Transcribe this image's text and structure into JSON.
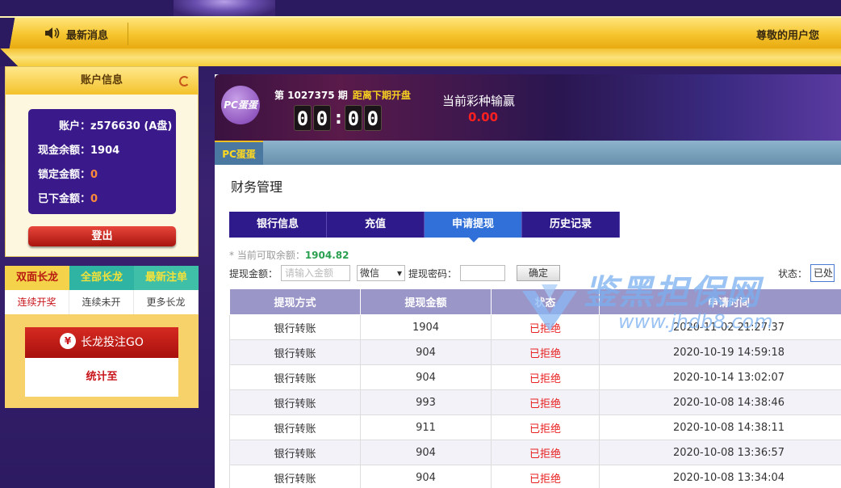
{
  "header": {
    "news_label": "最新消息",
    "greeting": "尊敬的用户您"
  },
  "account": {
    "title": "账户信息",
    "account_label": "账户：",
    "account_value": "z576630 (A盘)",
    "cash_label": "现金余额：",
    "cash_value": "1904",
    "locked_label": "锁定金额：",
    "locked_value": "0",
    "placed_label": "已下金额：",
    "placed_value": "0",
    "logout": "登出"
  },
  "dragon": {
    "tabs": [
      "双面长龙",
      "全部长龙",
      "最新注单"
    ],
    "subtabs": [
      "连续开奖",
      "连续未开",
      "更多长龙"
    ],
    "go_button": "长龙投注GO",
    "yen": "¥",
    "stats": "统计至"
  },
  "game": {
    "logo_text": "PC蛋蛋",
    "period": "第 1027375 期",
    "next_label": "距离下期开盘",
    "timer": [
      "0",
      "0",
      "0",
      "0"
    ],
    "win_label": "当前彩种输赢",
    "win_value": "0.00",
    "tab": "PC蛋蛋"
  },
  "finance": {
    "title": "财务管理",
    "tabs": [
      "银行信息",
      "充值",
      "申请提现",
      "历史记录"
    ],
    "active_tab": "申请提现",
    "note_prefix": "* 当前可取余额：",
    "note_value": "1904.82",
    "amount_label": "提现金额：",
    "amount_placeholder": "请输入金额",
    "method_value": "微信",
    "password_label": "提现密码：",
    "confirm": "确定",
    "status_label": "状态：",
    "status_value": "已处理",
    "columns": [
      "提现方式",
      "提现金额",
      "状态",
      "申请时间"
    ],
    "rows": [
      [
        "银行转账",
        "1904",
        "已拒绝",
        "2020-11-02 21:27:37"
      ],
      [
        "银行转账",
        "904",
        "已拒绝",
        "2020-10-19 14:59:18"
      ],
      [
        "银行转账",
        "904",
        "已拒绝",
        "2020-10-14 13:02:07"
      ],
      [
        "银行转账",
        "993",
        "已拒绝",
        "2020-10-08 14:38:46"
      ],
      [
        "银行转账",
        "911",
        "已拒绝",
        "2020-10-08 14:38:11"
      ],
      [
        "银行转账",
        "904",
        "已拒绝",
        "2020-10-08 13:36:57"
      ],
      [
        "银行转账",
        "904",
        "已拒绝",
        "2020-10-08 13:34:04"
      ]
    ]
  },
  "watermark": {
    "text": "鉴黑担保网",
    "url": "www.jhdb8.com"
  },
  "colors": {
    "brand_purple": "#2e1a8a",
    "active_blue": "#3070d8",
    "gold": "#f6c52e",
    "reject_red": "#e82020"
  }
}
